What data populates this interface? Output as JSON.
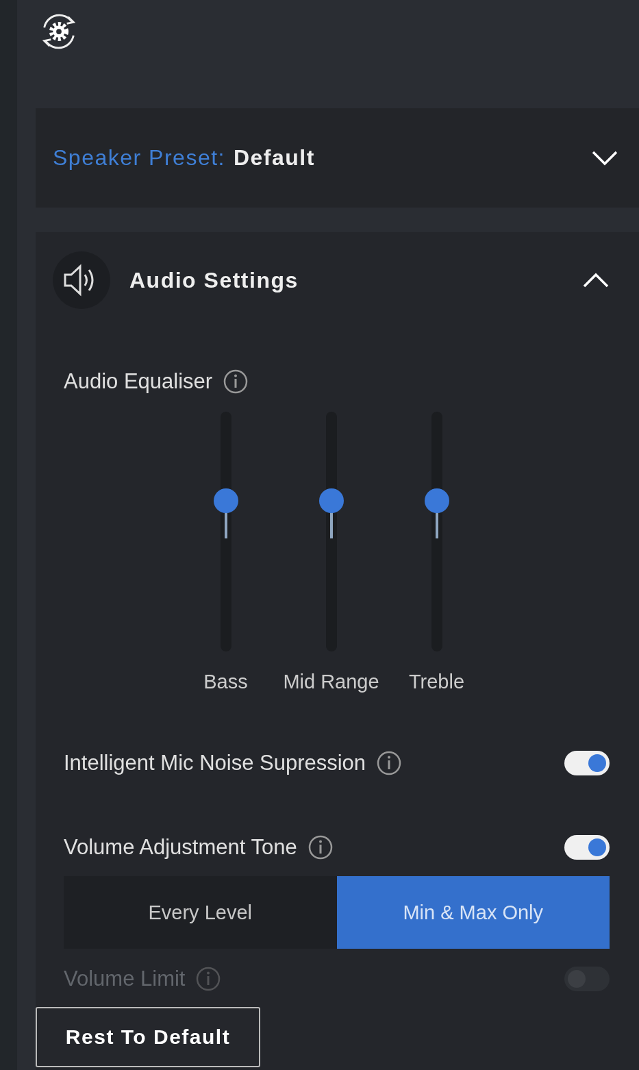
{
  "preset": {
    "label": "Speaker Preset:",
    "value": "Default",
    "expanded": false
  },
  "audio_settings": {
    "title": "Audio Settings",
    "expanded": true,
    "equaliser": {
      "label": "Audio Equaliser",
      "bands": [
        {
          "name": "Bass",
          "level": 0.63
        },
        {
          "name": "Mid Range",
          "level": 0.63
        },
        {
          "name": "Treble",
          "level": 0.63
        }
      ]
    },
    "toggles": [
      {
        "label": "Intelligent Mic Noise Supression",
        "on": true
      },
      {
        "label": "Volume Adjustment Tone",
        "on": true
      }
    ],
    "tone_options": [
      {
        "label": "Every Level",
        "selected": false
      },
      {
        "label": "Min & Max Only",
        "selected": true
      }
    ],
    "volume_limit": {
      "label": "Volume Limit",
      "on": false,
      "disabled": true
    }
  },
  "reset_button": "Rest To Default"
}
